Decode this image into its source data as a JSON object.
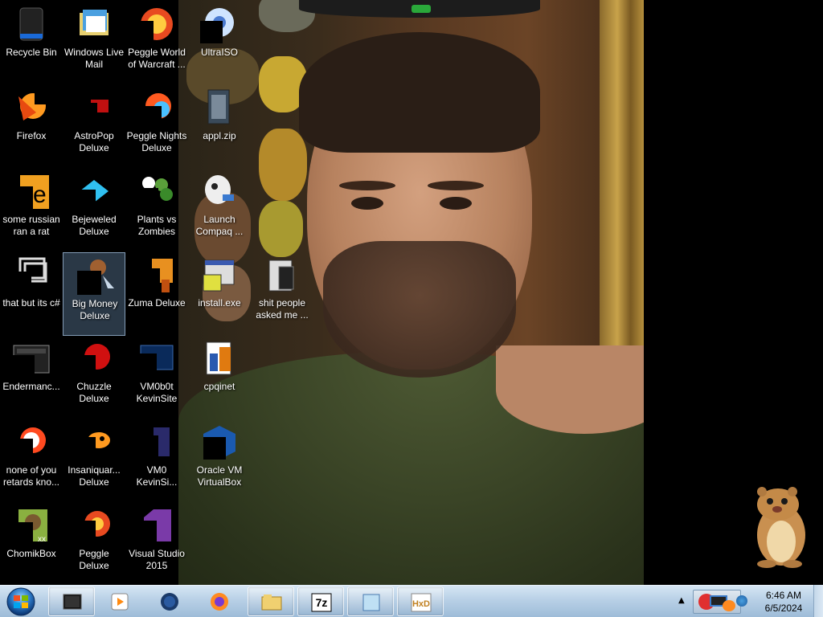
{
  "desktop": {
    "icons": [
      {
        "label": "Recycle Bin"
      },
      {
        "label": "Windows Live\nMail"
      },
      {
        "label": "Peggle World\nof Warcraft ..."
      },
      {
        "label": "UltraISO"
      },
      {
        "label": "Firefox"
      },
      {
        "label": "AstroPop\nDeluxe"
      },
      {
        "label": "Peggle Nights\nDeluxe"
      },
      {
        "label": "appl.zip"
      },
      {
        "label": "some russian\nran a rat"
      },
      {
        "label": "Bejeweled\nDeluxe"
      },
      {
        "label": "Plants vs\nZombies"
      },
      {
        "label": "Launch\nCompaq ..."
      },
      {
        "label": "that but its c#"
      },
      {
        "label": "Big Money\nDeluxe"
      },
      {
        "label": "Zuma Deluxe"
      },
      {
        "label": "install.exe"
      },
      {
        "label": "shit people\nasked me ..."
      },
      {
        "label": "Endermanc..."
      },
      {
        "label": "Chuzzle\nDeluxe"
      },
      {
        "label": "VM0b0t\nKevinSite"
      },
      {
        "label": "cpqinet"
      },
      {
        "label": "none of you\nretards kno..."
      },
      {
        "label": "Insaniquar...\nDeluxe"
      },
      {
        "label": "VM0\nKevinSi..."
      },
      {
        "label": "Oracle VM\nVirtualBox"
      },
      {
        "label": "ChomikBox"
      },
      {
        "label": "Peggle Deluxe"
      },
      {
        "label": "Visual Studio\n2015"
      }
    ],
    "selected_icon": "Big Money\nDeluxe"
  },
  "taskbar": {
    "start_icon": "windows-orb-icon",
    "buttons": [
      {
        "icon": "black-window-icon",
        "active": true
      },
      {
        "icon": "media-player-icon",
        "active": false
      },
      {
        "icon": "globe-icon",
        "active": false
      },
      {
        "icon": "firefox-icon",
        "active": false
      },
      {
        "icon": "file-explorer-icon",
        "active": true
      },
      {
        "icon": "7zip-icon",
        "label": "7z",
        "active": true
      },
      {
        "icon": "notepad-icon",
        "active": true
      },
      {
        "icon": "hxd-icon",
        "label": "HxD",
        "active": true
      }
    ],
    "tray": {
      "time": "6:46 AM",
      "date": "6/5/2024"
    }
  },
  "colors": {
    "taskbar": "#b8d0e6",
    "desktop_bg": "#000000",
    "selection": "#78a0c8"
  }
}
